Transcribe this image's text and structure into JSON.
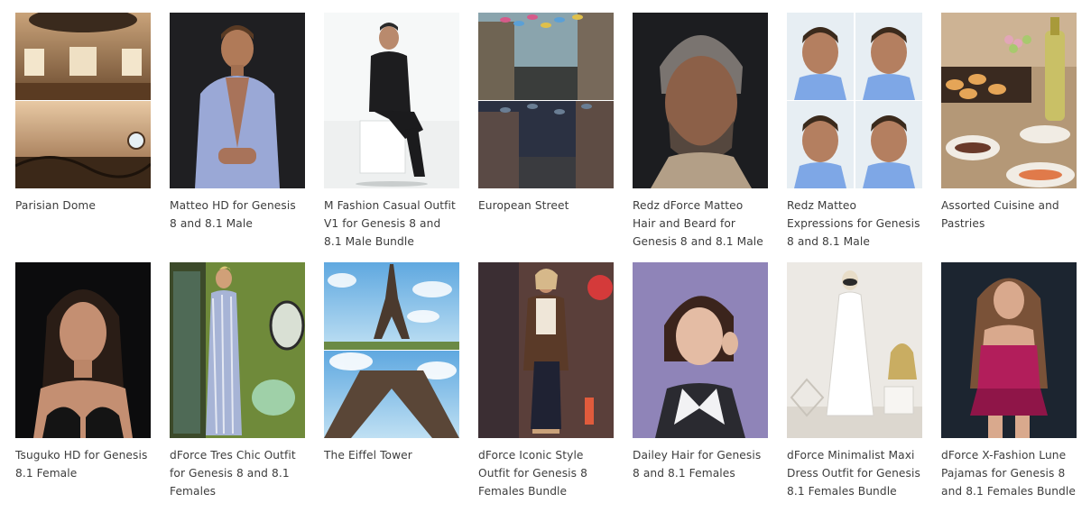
{
  "products": [
    {
      "title": "Parisian Dome",
      "image": "dome-interior"
    },
    {
      "title": "Matteo HD for Genesis 8 and 8.1 Male",
      "image": "male-figure-shirt"
    },
    {
      "title": "M Fashion Casual Outfit V1 for Genesis 8 and 8.1 Male Bundle",
      "image": "male-seated-outfit"
    },
    {
      "title": "European Street",
      "image": "street-scene"
    },
    {
      "title": "Redz dForce Matteo Hair and Beard for Genesis 8 and 8.1 Male",
      "image": "male-hair-beard"
    },
    {
      "title": "Redz Matteo Expressions for Genesis 8 and 8.1 Male",
      "image": "male-expressions"
    },
    {
      "title": "Assorted Cuisine and Pastries",
      "image": "food-table"
    },
    {
      "title": "Tsuguko HD for Genesis 8.1 Female",
      "image": "female-portrait"
    },
    {
      "title": "dForce Tres Chic Outfit for Genesis 8 and 8.1 Females",
      "image": "female-striped-dress"
    },
    {
      "title": "The Eiffel Tower",
      "image": "eiffel-tower"
    },
    {
      "title": "dForce Iconic Style Outfit for Genesis 8 Females Bundle",
      "image": "female-street-outfit"
    },
    {
      "title": "Dailey Hair for Genesis 8 and 8.1 Females",
      "image": "female-hair"
    },
    {
      "title": "dForce Minimalist Maxi Dress Outfit for Genesis 8.1 Females Bundle",
      "image": "white-maxi-dress"
    },
    {
      "title": "dForce X-Fashion Lune Pajamas for Genesis 8 and 8.1 Females Bundle",
      "image": "pink-pajamas"
    }
  ]
}
